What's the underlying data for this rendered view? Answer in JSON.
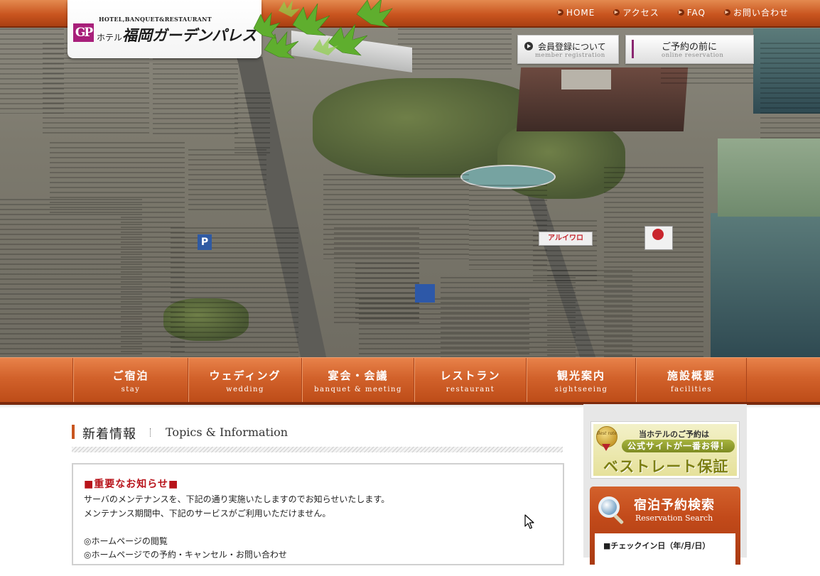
{
  "header": {
    "logo_small": "HOTEL,BANQUET&RESTAURANT",
    "logo_mark": "GP",
    "logo_prefix": "ホテル",
    "logo_name": "福岡ガーデンパレス",
    "top_nav": [
      {
        "label": "HOME"
      },
      {
        "label": "アクセス"
      },
      {
        "label": "FAQ"
      },
      {
        "label": "お問い合わせ"
      }
    ],
    "member_button": {
      "jp": "会員登録について",
      "en": "member registration"
    },
    "reserve_button": {
      "jp": "ご予約の前に",
      "en": "online reservation"
    }
  },
  "main_nav": [
    {
      "jp": "ご宿泊",
      "en": "stay"
    },
    {
      "jp": "ウェディング",
      "en": "wedding"
    },
    {
      "jp": "宴会・会議",
      "en": "banquet & meeting"
    },
    {
      "jp": "レストラン",
      "en": "restaurant"
    },
    {
      "jp": "観光案内",
      "en": "sightseeing"
    },
    {
      "jp": "施設概要",
      "en": "facilities"
    }
  ],
  "topics": {
    "title_jp": "新着情報",
    "title_en": "Topics & Information"
  },
  "news": {
    "title": "■重要なお知らせ■",
    "lines": [
      "サーバのメンテナンスを、下記の通り実施いたしますのでお知らせいたします。",
      "メンテナンス期間中、下記のサービスがご利用いただけません。",
      "◎ホームページの閲覧",
      "◎ホームページでの予約・キャンセル・お問い合わせ"
    ]
  },
  "sidebar": {
    "bestrate": {
      "medal": "Best rate",
      "line1": "当ホテルのご予約は",
      "line2": "公式サイトが一番お得！",
      "line3": "ベストレート保証"
    },
    "search": {
      "title": "宿泊予約検索",
      "subtitle": "Reservation Search",
      "checkin_label": "■チェックイン日（年/月/日）"
    }
  },
  "colors": {
    "accent_orange": "#c9551f",
    "dark_brown": "#7d2a0d",
    "logo_magenta": "#a81f7a",
    "news_red": "#b8131a"
  }
}
